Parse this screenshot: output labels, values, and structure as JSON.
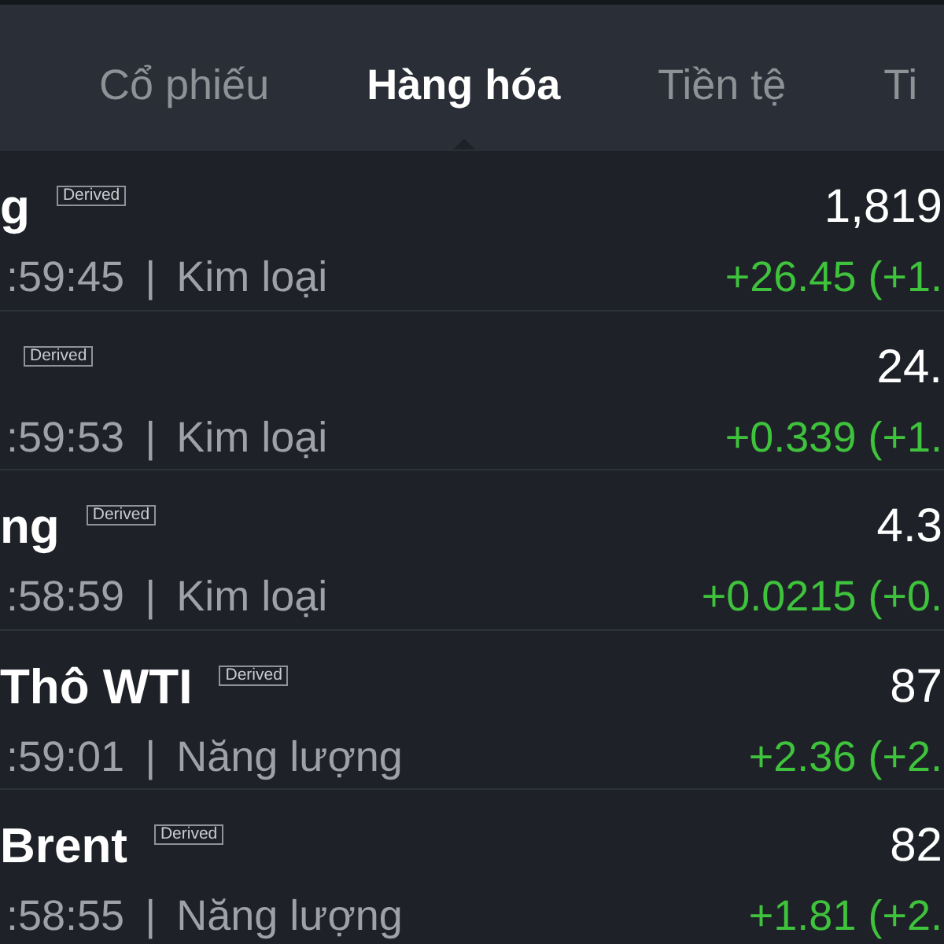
{
  "tabs": [
    {
      "label": "Cổ phiếu",
      "selected": false
    },
    {
      "label": "Hàng hóa",
      "selected": true
    },
    {
      "label": "Tiền tệ",
      "selected": false
    },
    {
      "label": "Ti",
      "selected": false
    }
  ],
  "rows": [
    {
      "name": "g",
      "badge": "Derived",
      "time": ":59:45",
      "separator": "|",
      "category": "Kim loại",
      "price": "1,819",
      "change": "+26.45 (+1.",
      "positive": true
    },
    {
      "badge": "Derived",
      "time": ":59:53",
      "separator": "|",
      "category": "Kim loại",
      "price": "24.",
      "change": "+0.339 (+1.",
      "positive": true
    },
    {
      "name": "ng",
      "badge": "Derived",
      "time": ":58:59",
      "separator": "|",
      "category": "Kim loại",
      "price": "4.3",
      "change": "+0.0215 (+0.",
      "positive": true
    },
    {
      "name": "Thô WTI",
      "badge": "Derived",
      "time": ":59:01",
      "separator": "|",
      "category": "Năng lượng",
      "price": "87",
      "change": "+2.36 (+2.",
      "positive": true
    },
    {
      "name": "Brent",
      "badge": "Derived",
      "time": ":58:55",
      "separator": "|",
      "category": "Năng lượng",
      "price": "82",
      "change": "+1.81 (+2.",
      "positive": true
    }
  ]
}
